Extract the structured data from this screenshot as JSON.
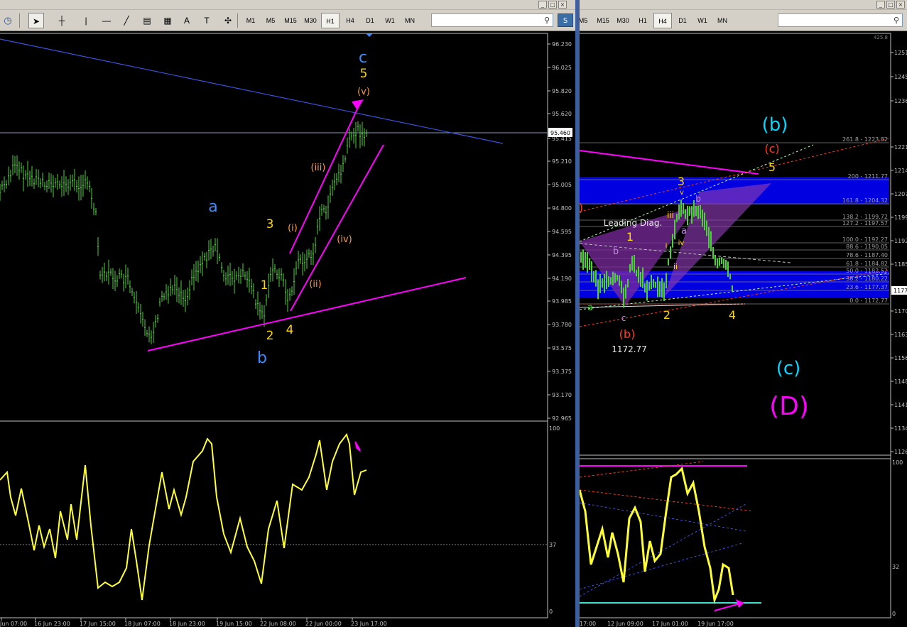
{
  "left_toolbar": {
    "clock_icon": "clock-icon",
    "tools": [
      {
        "name": "cursor-icon",
        "glyph": "➤"
      },
      {
        "name": "crosshair-icon",
        "glyph": "┼"
      },
      {
        "name": "vertical-line-icon",
        "glyph": "|"
      },
      {
        "name": "horizontal-line-icon",
        "glyph": "—"
      },
      {
        "name": "trendline-icon",
        "glyph": "╱"
      },
      {
        "name": "fibonacci-channel-icon",
        "glyph": "▤"
      },
      {
        "name": "fibonacci-icon",
        "glyph": "▦"
      },
      {
        "name": "text-icon",
        "glyph": "A"
      },
      {
        "name": "text-label-icon",
        "glyph": "T"
      },
      {
        "name": "arrow-tool-icon",
        "glyph": "✣"
      }
    ],
    "timeframes": [
      "M1",
      "M5",
      "M15",
      "M30",
      "H1",
      "H4",
      "D1",
      "W1",
      "MN"
    ],
    "active_timeframe": "H1",
    "search_icon": "search-icon",
    "search_button": "S"
  },
  "right_toolbar": {
    "timeframes": [
      "M5",
      "M15",
      "M30",
      "H1",
      "H4",
      "D1",
      "W1",
      "MN"
    ],
    "active_timeframe": "H4",
    "search_icon": "search-icon"
  },
  "left_chart": {
    "price_labels": [
      "96.230",
      "96.025",
      "95.820",
      "95.620",
      "95.460",
      "95.415",
      "95.210",
      "95.005",
      "94.800",
      "94.595",
      "94.395",
      "94.190",
      "93.985",
      "93.780",
      "93.575",
      "93.375",
      "93.170",
      "92.965"
    ],
    "current_price": "95.460",
    "labels": {
      "c_big": "c",
      "five": "5",
      "v": "(v)",
      "iii": "(iii)",
      "i": "(i)",
      "iv": "(iv)",
      "ii": "(ii)",
      "a": "a",
      "three": "3",
      "one": "1",
      "two": "2",
      "four": "4",
      "b": "b"
    }
  },
  "left_indicator": {
    "scale": [
      "100",
      "37",
      "0"
    ]
  },
  "left_time_axis": [
    "Jun 07:00",
    "16 Jun 23:00",
    "17 Jun 15:00",
    "18 Jun 07:00",
    "18 Jun 23:00",
    "19 Jun 15:00",
    "22 Jun 08:00",
    "22 Jun 00:00",
    "23 Jun 17:00"
  ],
  "right_chart": {
    "top_price": "425.8",
    "price_labels": [
      "1251",
      "1245",
      "1236",
      "1221",
      "1214",
      "1207",
      "1199",
      "1192",
      "1185",
      "1177",
      "1170",
      "1163",
      "1156",
      "1148",
      "1141",
      "1134",
      "1126"
    ],
    "current_price_tag": "1177",
    "fib_levels": [
      "261.8 - 1223.82",
      "200 - 1211.77",
      "161.8 - 1204.32",
      "138.2 - 1199.72",
      "127.2 - 1197.57",
      "100.0 - 1192.27",
      "88.6 - 1190.05",
      "78.6 - 1187.40",
      "61.8 - 1184.82",
      "50.0 - 1182.52",
      "38.2 - 1180.22",
      "23.6 - 1177.37",
      "0.0 - 1172.77"
    ],
    "labels": {
      "b_paren": "(b)",
      "c_red": "(c)",
      "five": "5",
      "three": "3",
      "v_small": "v",
      "b_small": "b",
      "iii": "iii",
      "a_small": "a",
      "iv": "iv",
      "i_small": "i",
      "ii": "ii",
      "leading": "Leading Diag.",
      "one": "1",
      "b_purple": "b",
      "a_green": "a",
      "c_small": "c",
      "two": "2",
      "four": "4",
      "b_red": "(b)",
      "low_value": "1172.77",
      "c_cyan": "(c)",
      "D": "(D)",
      "left_paren": ")"
    }
  },
  "right_indicator": {
    "scale": [
      "100",
      "32",
      "0"
    ]
  },
  "right_time_axis": [
    "17:00",
    "12 Jun 09:00",
    "17 Jun 01:00",
    "19 Jun 17:00"
  ],
  "colors": {
    "candles": "#4cd137",
    "magenta": "#ff00ff",
    "yellow": "#ffd700",
    "blue_wave": "#3c8cff",
    "cyan": "#00d8ff",
    "orange": "#ff9a3c",
    "red": "#ff3b1f",
    "zone_blue": "#0000e0"
  }
}
